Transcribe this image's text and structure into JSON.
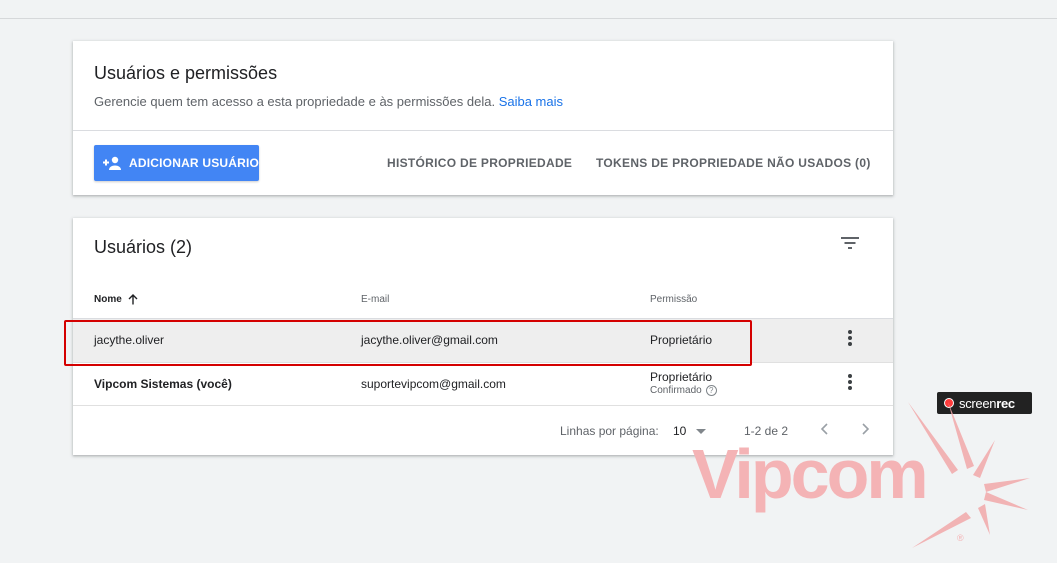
{
  "properties_card": {
    "title": "Usuários e permissões",
    "subtitle": "Gerencie quem tem acesso a esta propriedade e às permissões dela.",
    "learn_more": "Saiba mais",
    "add_user_label": "ADICIONAR USUÁRIO",
    "history_label": "HISTÓRICO DE PROPRIEDADE",
    "tokens_label": "TOKENS DE PROPRIEDADE NÃO USADOS (0)"
  },
  "users_card": {
    "title": "Usuários (2)",
    "columns": {
      "name": "Nome",
      "email": "E-mail",
      "permission": "Permissão"
    },
    "rows": [
      {
        "name": "jacythe.oliver",
        "email": "jacythe.oliver@gmail.com",
        "permission": "Proprietário",
        "highlighted": true
      },
      {
        "name": "Vipcom Sistemas (você)",
        "email": "suportevipcom@gmail.com",
        "permission": "Proprietário",
        "status": "Confirmado"
      }
    ],
    "pagination": {
      "rows_per_page_label": "Linhas por página:",
      "rows_per_page": "10",
      "range": "1-2 de 2"
    }
  },
  "overlay": {
    "recorder_brand_light": "screen",
    "recorder_brand_bold": "rec",
    "watermark_text": "Vipcom",
    "watermark_mark": "®"
  },
  "colors": {
    "accent": "#4285f4",
    "link": "#1a73e8",
    "highlight_border": "#d40000"
  }
}
